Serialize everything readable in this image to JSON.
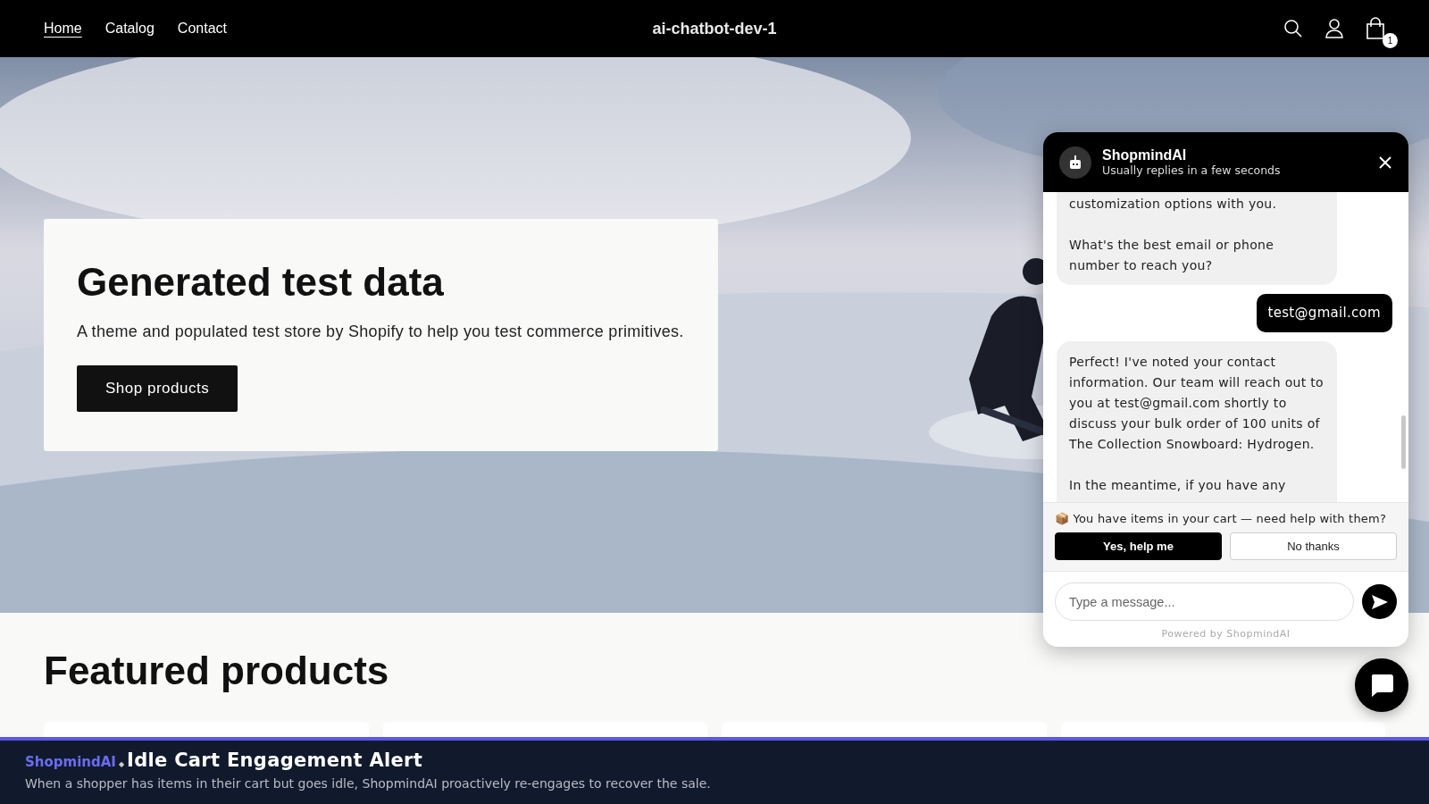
{
  "header": {
    "nav": [
      {
        "label": "Home",
        "selected": true
      },
      {
        "label": "Catalog",
        "selected": false
      },
      {
        "label": "Contact",
        "selected": false
      }
    ],
    "store_name": "ai-chatbot-dev-1",
    "cart_count": "1"
  },
  "hero": {
    "kind": "picture",
    "title": "Generated test data",
    "text": "A theme and populated test store by Shopify to help you test commerce primitives.",
    "button": "Shop products"
  },
  "featured": {
    "title": "Featured products"
  },
  "chat": {
    "name": "ShopmindAI",
    "status": "Usually replies in a few seconds",
    "messages": [
      {
        "kind": "bot",
        "text": "customization options with you.\n\nWhat's the best email or phone number to reach you?"
      },
      {
        "kind": "user",
        "text": "test@gmail.com"
      },
      {
        "kind": "bot",
        "text": "Perfect! I've noted your contact information. Our team will reach out to you at test@gmail.com shortly to discuss your bulk order of 100 units of The Collection Snowboard: Hydrogen.\n\nIn the meantime, if you have any"
      }
    ],
    "nudge": {
      "icon": "📦",
      "text": "You have items in your cart — need help with them?",
      "buttons": [
        {
          "label": "Yes, help me",
          "kind": "primary"
        },
        {
          "label": "No thanks",
          "kind": "secondary"
        }
      ]
    },
    "input": {
      "placeholder": "Type a message..."
    },
    "footer": "Powered by ShopmindAI"
  },
  "banner": {
    "brand": "ShopmindAI",
    "separator": "◆",
    "title": "Idle Cart Engagement Alert",
    "text": "When a shopper has items in their cart but goes idle, ShopmindAI proactively re-engages to recover the sale."
  }
}
